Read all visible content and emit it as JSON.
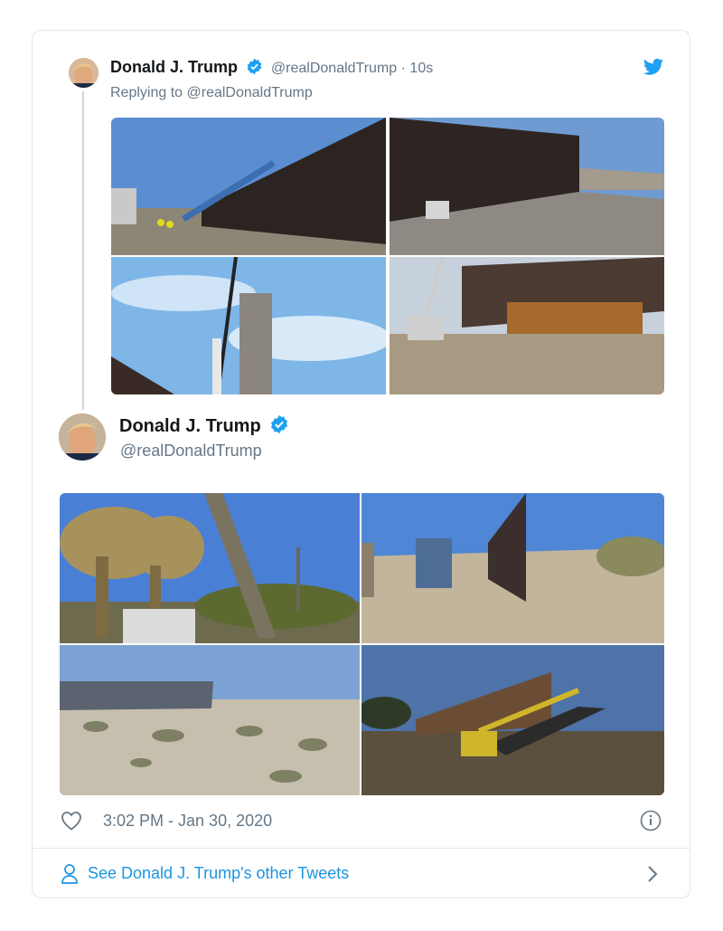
{
  "reply_tweet": {
    "author_name": "Donald J. Trump",
    "handle": "@realDonaldTrump",
    "time_ago": "· 10s",
    "replying_to": "Replying to @realDonaldTrump",
    "media": [
      "border-wall-photo-1",
      "border-wall-photo-2",
      "border-wall-photo-3",
      "border-wall-photo-4"
    ]
  },
  "main_tweet": {
    "author_name": "Donald J. Trump",
    "handle": "@realDonaldTrump",
    "media": [
      "border-wall-photo-5",
      "border-wall-photo-6",
      "border-wall-photo-7",
      "border-wall-photo-8"
    ]
  },
  "footer": {
    "timestamp": "3:02 PM - Jan 30, 2020",
    "other_tweets_link": "See Donald J. Trump's other Tweets"
  },
  "icons": {
    "brand": "twitter-bird-icon",
    "verified": "verified-badge-icon",
    "like": "heart-icon",
    "info": "info-icon",
    "person": "person-icon",
    "chevron": "chevron-right-icon"
  },
  "colors": {
    "accent": "#1da1f2",
    "link": "#1b95e0",
    "text_secondary": "#657786",
    "border": "#e1e8ed"
  }
}
